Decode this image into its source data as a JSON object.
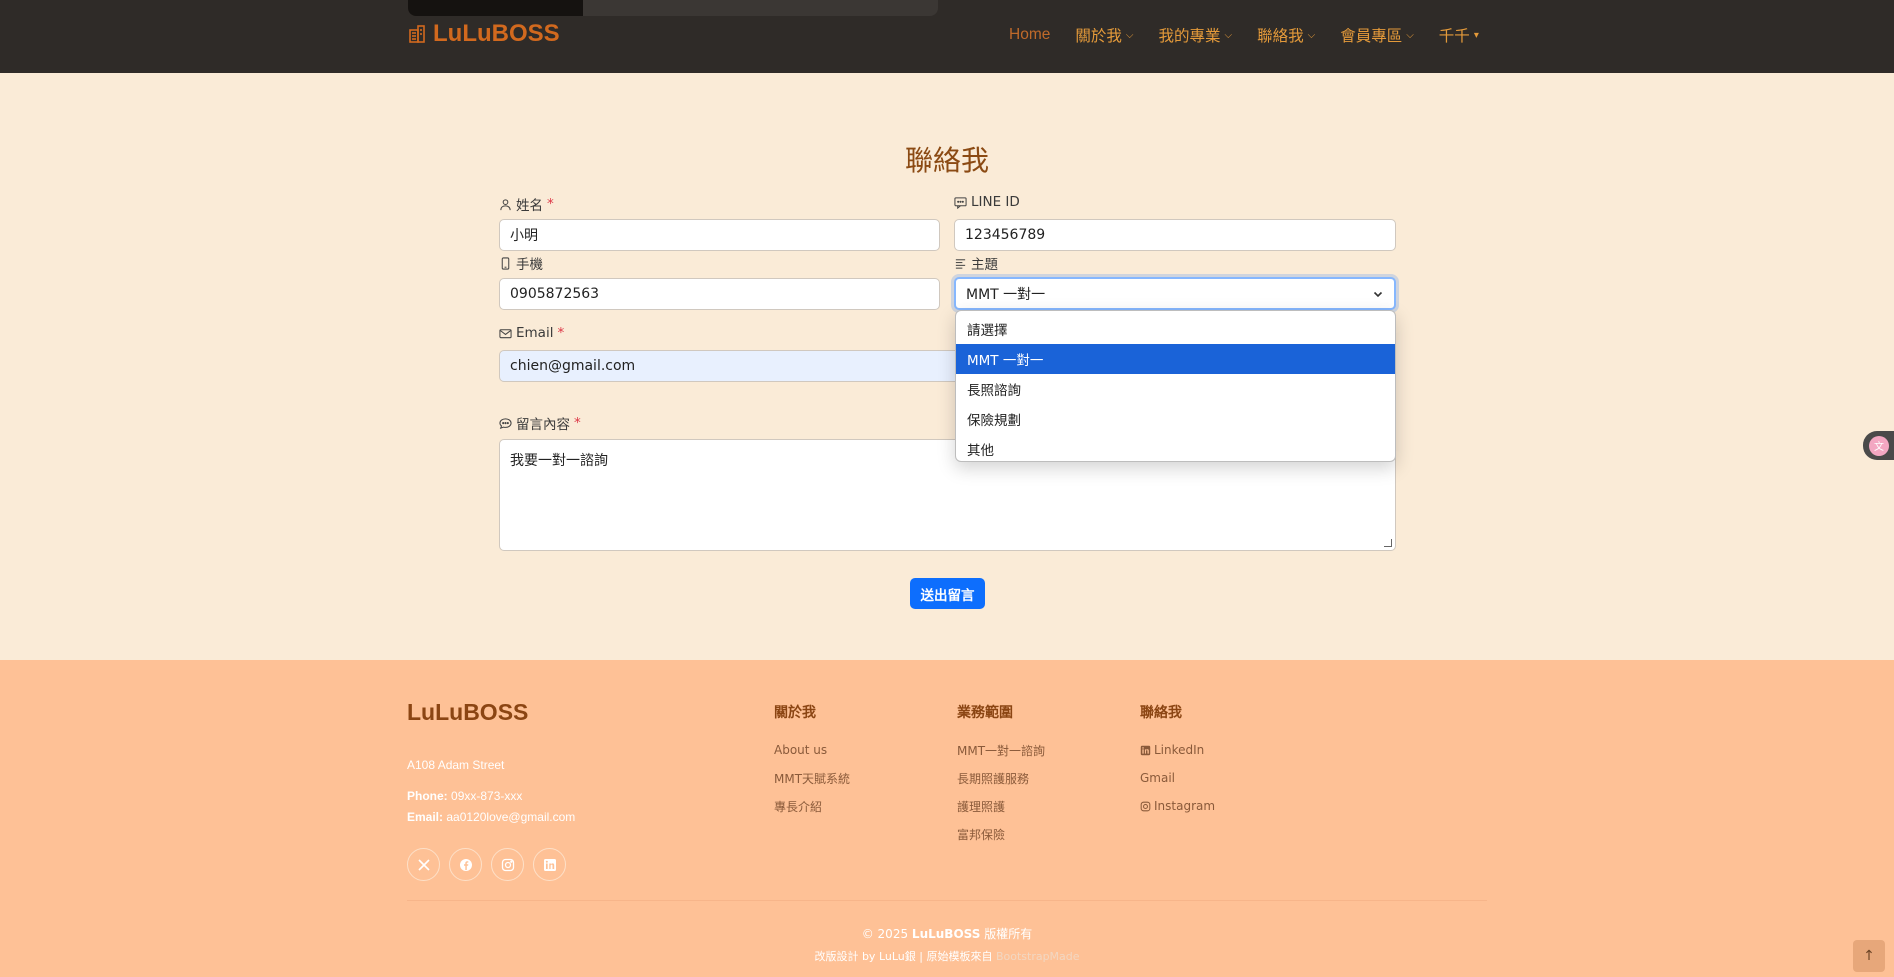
{
  "header": {
    "brand": "LuLuBOSS",
    "nav": [
      {
        "label": "Home",
        "active": true,
        "has_dropdown": false
      },
      {
        "label": "關於我",
        "has_dropdown": true
      },
      {
        "label": "我的專業",
        "has_dropdown": true
      },
      {
        "label": "聯絡我",
        "has_dropdown": true
      },
      {
        "label": "會員專區",
        "has_dropdown": true
      },
      {
        "label": "千千",
        "has_dropdown": true
      }
    ]
  },
  "form": {
    "title": "聯絡我",
    "name": {
      "label": "姓名",
      "required": "*",
      "value": "小明"
    },
    "line": {
      "label": "LINE ID",
      "value": "123456789"
    },
    "phone": {
      "label": "手機",
      "value": "0905872563"
    },
    "subject": {
      "label": "主題",
      "value": "MMT 一對一",
      "options": [
        "請選擇",
        "MMT 一對一",
        "長照諮詢",
        "保險規劃",
        "其他"
      ],
      "selected_index": 1
    },
    "email": {
      "label": "Email",
      "required": "*",
      "value": "chien@gmail.com"
    },
    "message": {
      "label": "留言內容",
      "required": "*",
      "value": "我要一對一諮詢"
    },
    "submit_label": "送出留言"
  },
  "footer": {
    "brand": "LuLuBOSS",
    "address": "A108 Adam Street",
    "phone_label": "Phone:",
    "phone": "09xx-873-xxx",
    "email_label": "Email:",
    "email": "aa0120love@gmail.com",
    "socials": [
      "x-icon",
      "facebook-icon",
      "instagram-icon",
      "linkedin-icon"
    ],
    "columns": [
      {
        "title": "關於我",
        "links": [
          "About us",
          "MMT天賦系統",
          "專長介紹"
        ]
      },
      {
        "title": "業務範圍",
        "links": [
          "MMT一對一諮詢",
          "長期照護服務",
          "護理照護",
          "富邦保險"
        ]
      },
      {
        "title": "聯絡我",
        "links": [
          "LinkedIn",
          "Gmail",
          "Instagram"
        ]
      }
    ],
    "copyright_prefix": "© 2025",
    "copyright_brand": "LuLuBOSS",
    "copyright_suffix": "版權所有",
    "credits_text": "改版設計 by LuLu銀 | 原始模板來自",
    "credits_link": "BootstrapMade"
  },
  "colors": {
    "header_bg": "#2f2b28",
    "page_bg": "#faebd7",
    "footer_bg": "#fec196",
    "accent": "#d2691e",
    "primary": "#0d6efd"
  }
}
